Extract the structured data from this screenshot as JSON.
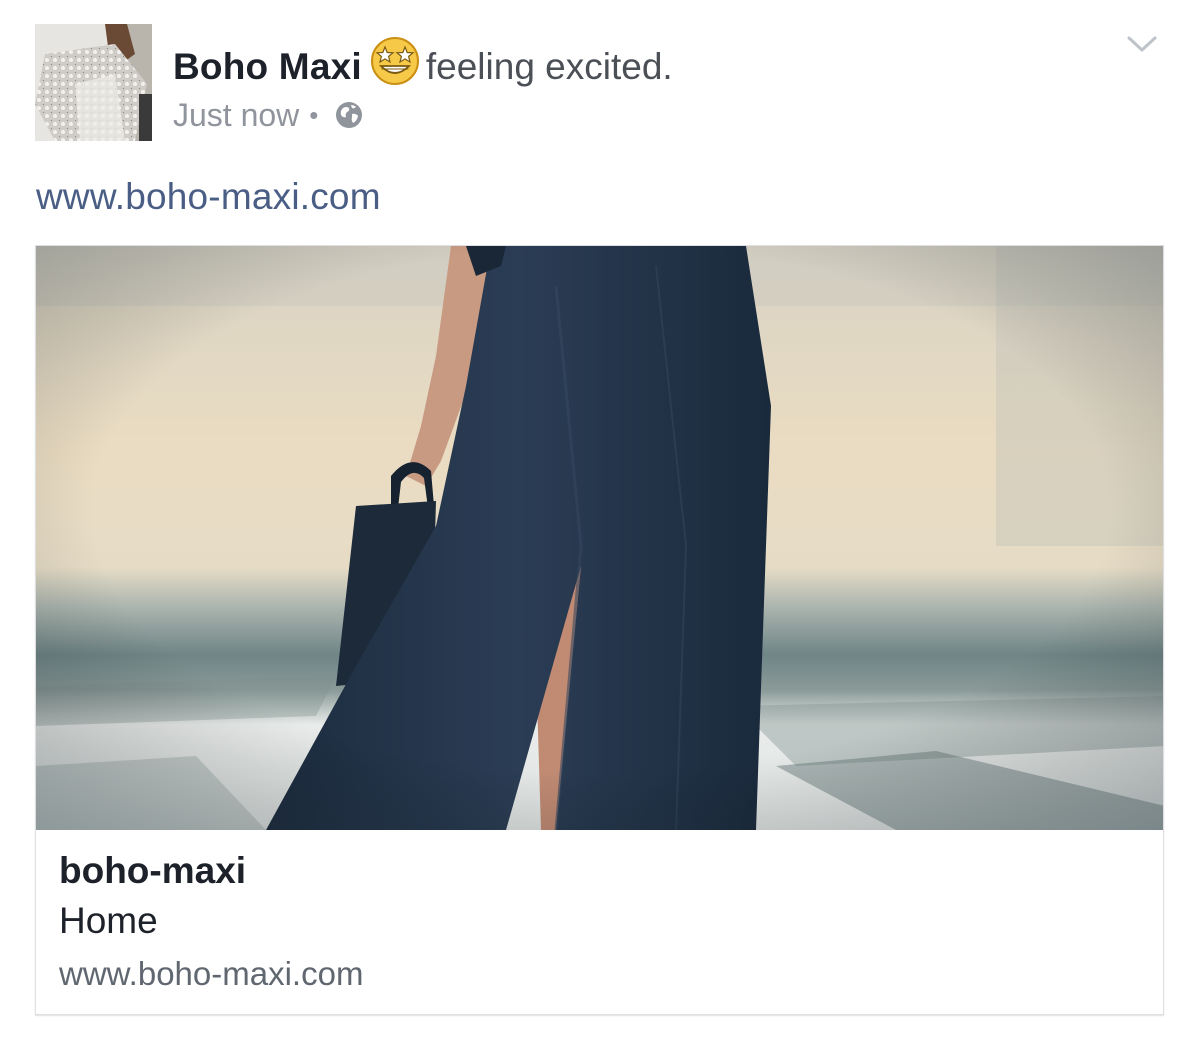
{
  "post": {
    "author_name": "Boho Maxi",
    "activity": "feeling excited.",
    "timestamp": "Just now",
    "separator": "•",
    "privacy_icon": "globe-icon",
    "feeling_icon": "star-struck-emoji-icon",
    "options_icon": "chevron-down-icon",
    "link_text": "www.boho-maxi.com"
  },
  "link_preview": {
    "title": "boho-maxi",
    "subtitle": "Home",
    "domain": "www.boho-maxi.com"
  },
  "colors": {
    "name_text": "#1d2129",
    "secondary_text": "#90949c",
    "link_text": "#4a5e85",
    "card_border": "#dddfe2"
  }
}
